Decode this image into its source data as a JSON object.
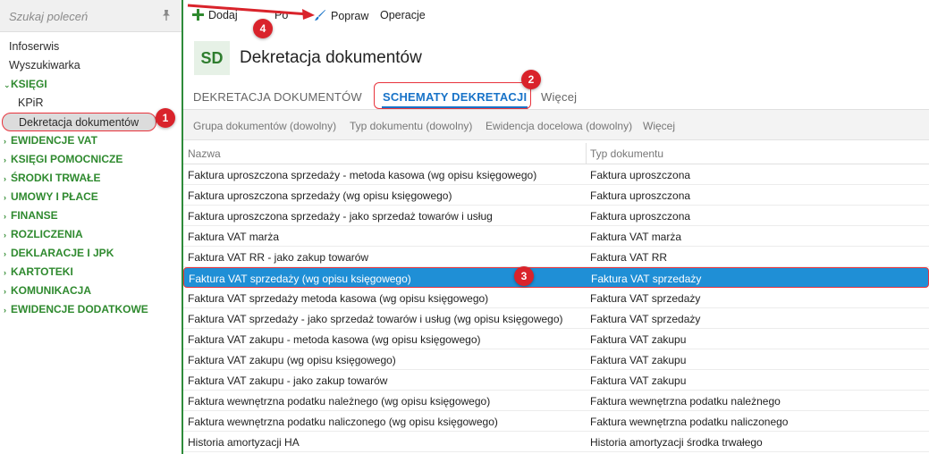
{
  "sidebar": {
    "search_placeholder": "Szukaj poleceń",
    "items": [
      {
        "label": "Infoserwis",
        "kind": "plain"
      },
      {
        "label": "Wyszukiwarka",
        "kind": "plain"
      },
      {
        "label": "KSIĘGI",
        "kind": "section-open"
      },
      {
        "label": "KPiR",
        "kind": "sub"
      },
      {
        "label": "Dekretacja dokumentów",
        "kind": "sub-active"
      },
      {
        "label": "EWIDENCJE VAT",
        "kind": "section"
      },
      {
        "label": "KSIĘGI POMOCNICZE",
        "kind": "section"
      },
      {
        "label": "ŚRODKI TRWAŁE",
        "kind": "section"
      },
      {
        "label": "UMOWY I PŁACE",
        "kind": "section"
      },
      {
        "label": "FINANSE",
        "kind": "section"
      },
      {
        "label": "ROZLICZENIA",
        "kind": "section"
      },
      {
        "label": "DEKLARACJE I JPK",
        "kind": "section"
      },
      {
        "label": "KARTOTEKI",
        "kind": "section"
      },
      {
        "label": "KOMUNIKACJA",
        "kind": "section"
      },
      {
        "label": "EWIDENCJE DODATKOWE",
        "kind": "section"
      }
    ]
  },
  "toolbar": {
    "add_label": "Dodaj",
    "copy_label": "Po",
    "edit_label": "Popraw",
    "operations_label": "Operacje"
  },
  "header": {
    "badge": "SD",
    "title": "Dekretacja dokumentów"
  },
  "tabs": {
    "items": [
      "DEKRETACJA DOKUMENTÓW",
      "SCHEMATY DEKRETACJI",
      "Więcej"
    ],
    "active_index": 1
  },
  "filters": [
    "Grupa dokumentów (dowolny)",
    "Typ dokumentu (dowolny)",
    "Ewidencja docelowa (dowolny)",
    "Więcej"
  ],
  "table": {
    "columns": [
      "Nazwa",
      "Typ dokumentu"
    ],
    "rows": [
      [
        "Faktura uproszczona sprzedaży - metoda kasowa (wg opisu księgowego)",
        "Faktura uproszczona"
      ],
      [
        "Faktura uproszczona sprzedaży (wg opisu księgowego)",
        "Faktura uproszczona"
      ],
      [
        "Faktura uproszczona sprzedaży - jako sprzedaż towarów i usług",
        "Faktura uproszczona"
      ],
      [
        "Faktura VAT marża",
        "Faktura VAT marża"
      ],
      [
        "Faktura VAT RR - jako zakup towarów",
        "Faktura VAT RR"
      ],
      [
        "Faktura VAT sprzedaży (wg opisu księgowego)",
        "Faktura VAT sprzedaży"
      ],
      [
        "Faktura VAT sprzedaży metoda kasowa (wg opisu księgowego)",
        "Faktura VAT sprzedaży"
      ],
      [
        "Faktura VAT sprzedaży - jako sprzedaż towarów i usług (wg opisu księgowego)",
        "Faktura VAT sprzedaży"
      ],
      [
        "Faktura VAT zakupu - metoda kasowa (wg opisu księgowego)",
        "Faktura VAT zakupu"
      ],
      [
        "Faktura VAT zakupu (wg opisu księgowego)",
        "Faktura VAT zakupu"
      ],
      [
        "Faktura VAT zakupu - jako zakup towarów",
        "Faktura VAT zakupu"
      ],
      [
        "Faktura wewnętrzna podatku należnego (wg opisu księgowego)",
        "Faktura wewnętrzna podatku należnego"
      ],
      [
        "Faktura wewnętrzna podatku naliczonego (wg opisu księgowego)",
        "Faktura wewnętrzna podatku naliczonego"
      ],
      [
        "Historia amortyzacji HA",
        "Historia amortyzacji środka trwałego"
      ]
    ],
    "selected_index": 5
  },
  "markers": [
    "1",
    "2",
    "3",
    "4"
  ],
  "colors": {
    "accent_green": "#2f8a2f",
    "tab_blue": "#1873c8",
    "selection_blue": "#1f8fd6",
    "annotation_red": "#d9232b"
  },
  "icons": {
    "add": "plus-icon",
    "edit": "brush-icon",
    "pin": "pin-icon"
  }
}
